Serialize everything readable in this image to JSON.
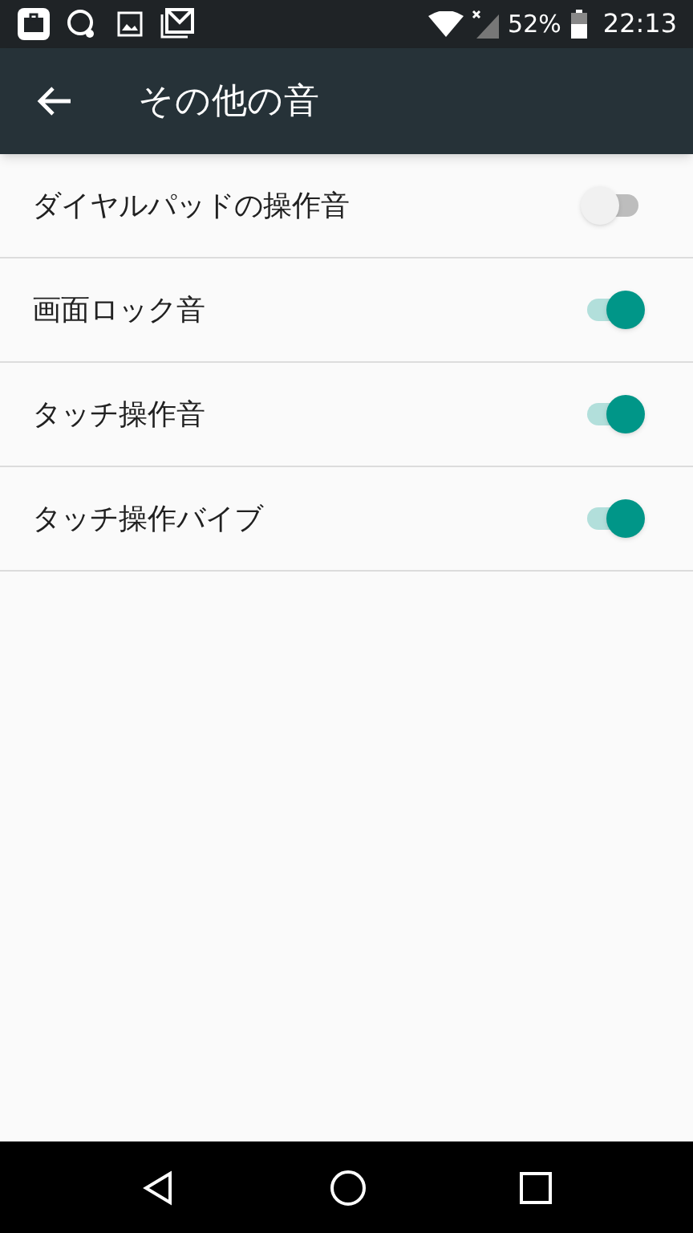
{
  "status_bar": {
    "battery_percent": "52%",
    "time": "22:13"
  },
  "app_bar": {
    "title": "その他の音"
  },
  "settings": [
    {
      "label": "ダイヤルパッドの操作音",
      "on": false
    },
    {
      "label": "画面ロック音",
      "on": true
    },
    {
      "label": "タッチ操作音",
      "on": true
    },
    {
      "label": "タッチ操作バイブ",
      "on": true
    }
  ]
}
